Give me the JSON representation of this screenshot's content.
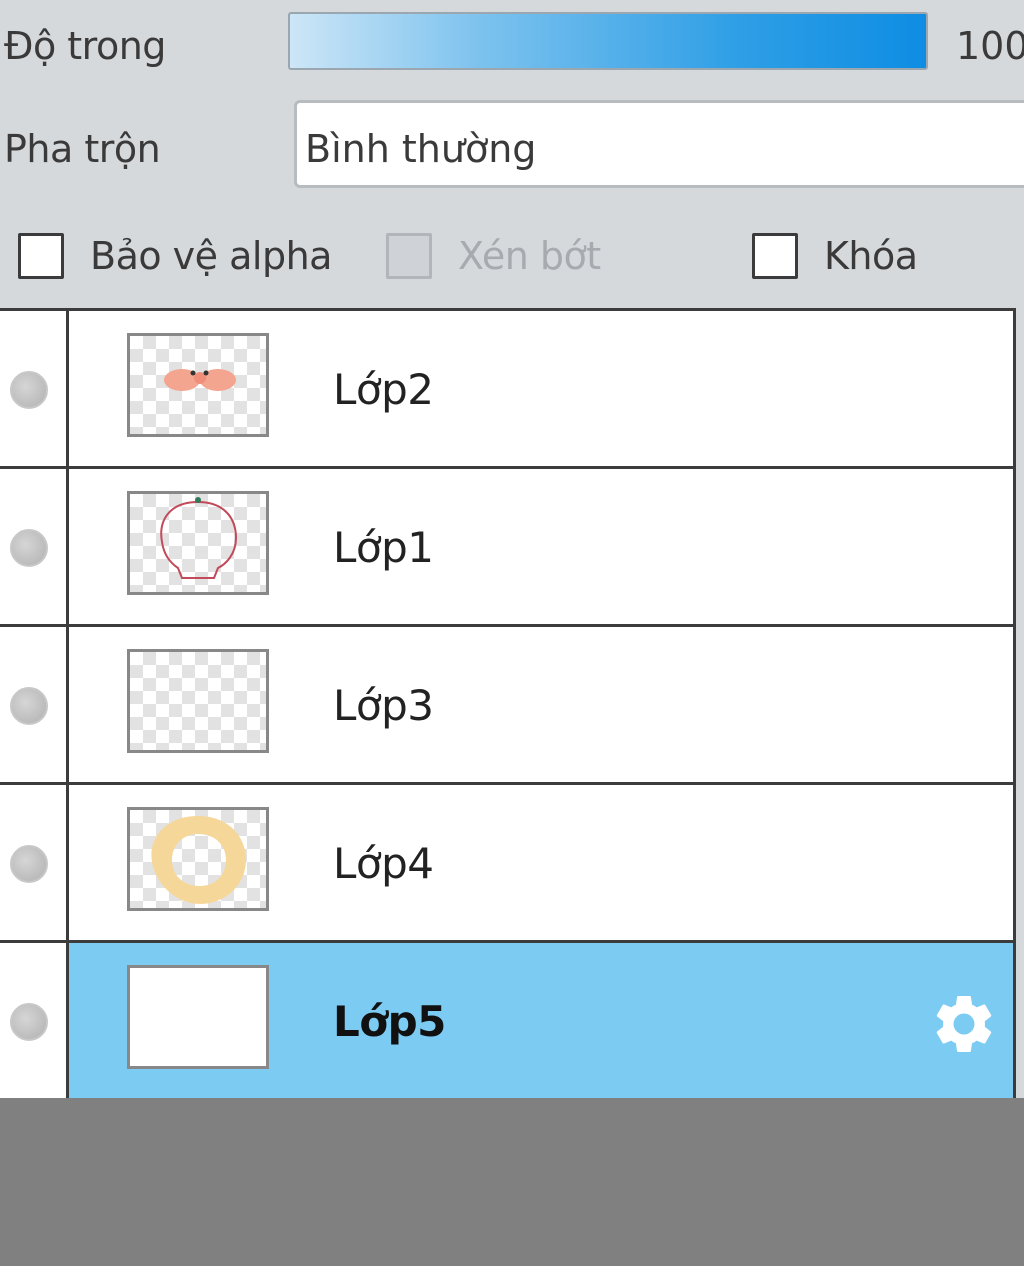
{
  "properties": {
    "opacity_label": "Độ trong",
    "opacity_value": "100",
    "blend_label": "Pha trộn",
    "blend_value": "Bình thường"
  },
  "options": {
    "protect_alpha_label": "Bảo vệ alpha",
    "clipping_label": "Xén bớt",
    "lock_label": "Khóa"
  },
  "layers": [
    {
      "name": "Lớp2",
      "selected": false
    },
    {
      "name": "Lớp1",
      "selected": false
    },
    {
      "name": "Lớp3",
      "selected": false
    },
    {
      "name": "Lớp4",
      "selected": false
    },
    {
      "name": "Lớp5",
      "selected": true
    }
  ],
  "icons": {
    "settings": "gear-icon",
    "visibility": "visibility-dot-icon"
  },
  "colors": {
    "selection": "#7ccbf3",
    "slider_accent": "#0e8de3"
  }
}
